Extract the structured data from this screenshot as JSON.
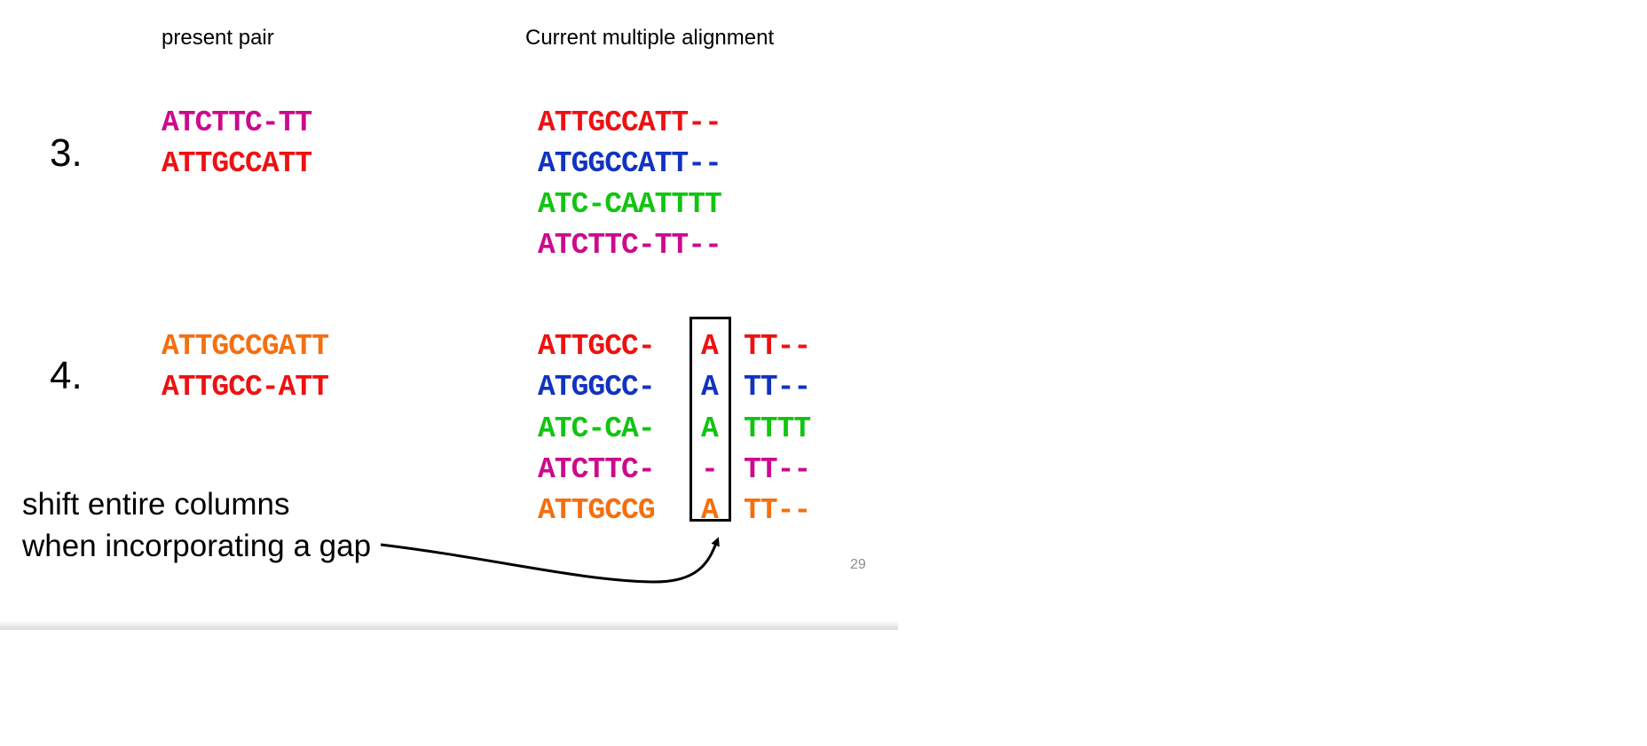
{
  "headings": {
    "present_pair": "present pair",
    "current_alignment": "Current multiple alignment"
  },
  "steps": [
    {
      "number": "3.",
      "pair": [
        "ATCTTC-TT",
        "ATTGCCATT"
      ],
      "alignment": [
        "ATTGCCATT--",
        "ATGGCCATT--",
        "ATC-CAATTTT",
        "ATCTTC-TT--"
      ]
    },
    {
      "number": "4.",
      "pair": [
        "ATTGCCGATT",
        "ATTGCC-ATT"
      ],
      "alignment": [
        {
          "left": "ATTGCC-",
          "mid": "A",
          "right": "TT--"
        },
        {
          "left": "ATGGCC-",
          "mid": "A",
          "right": "TT--"
        },
        {
          "left": "ATC-CA-",
          "mid": "A",
          "right": "TTTT"
        },
        {
          "left": "ATCTTC-",
          "mid": "-",
          "right": "TT--"
        },
        {
          "left": "ATTGCCG",
          "mid": "A",
          "right": "TT--"
        }
      ]
    }
  ],
  "note": {
    "line1": "shift entire columns",
    "line2": "when incorporating a gap"
  },
  "page_number": "29",
  "colors": {
    "magenta": "#cc0a8e",
    "red": "#ee1111",
    "blue": "#1133c0",
    "green": "#11c411",
    "orange": "#f46f0f"
  }
}
